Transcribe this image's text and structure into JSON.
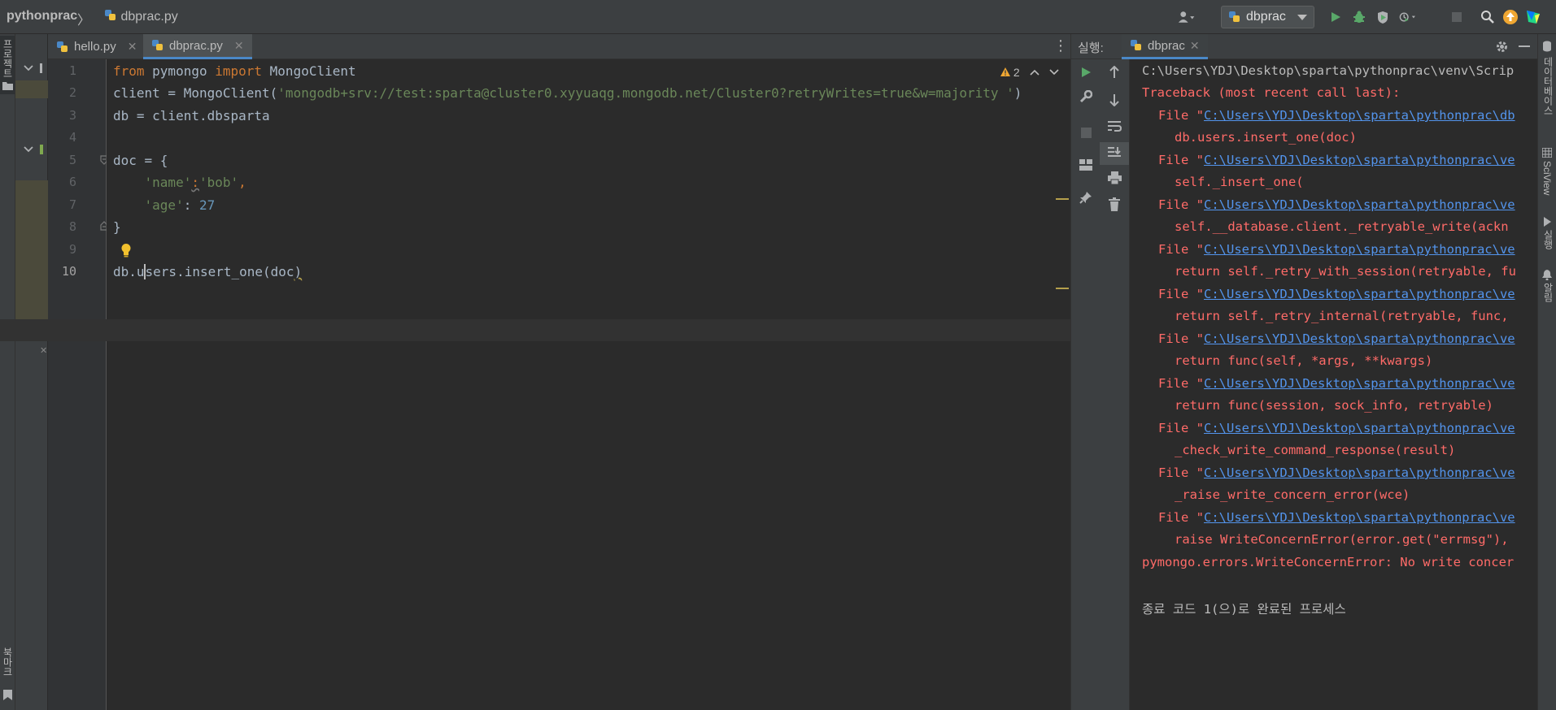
{
  "breadcrumb": {
    "project": "pythonprac",
    "separator": "〉",
    "file": "dbprac.py"
  },
  "toolbar": {
    "run_config": "dbprac",
    "user_icon": "user-icon",
    "run_icon": "run-icon",
    "debug_icon": "debug-icon",
    "coverage_icon": "coverage-icon",
    "profile_icon": "profile-icon",
    "stop_icon": "stop-icon",
    "search_icon": "search-icon",
    "update_icon": "update-icon",
    "jetbrains_icon": "jetbrains-icon"
  },
  "left_stripe": {
    "project_label": "프로젝트",
    "bookmarks_label": "북마크"
  },
  "tabs": [
    {
      "label": "hello.py",
      "close": "✕"
    },
    {
      "label": "dbprac.py",
      "close": "✕"
    }
  ],
  "editor": {
    "warning_count": "2",
    "line_numbers": [
      "1",
      "2",
      "3",
      "4",
      "5",
      "6",
      "7",
      "8",
      "9",
      "10"
    ]
  },
  "run_panel": {
    "label": "실행:",
    "tab_label": "dbprac",
    "tab_close": "✕"
  },
  "console": {
    "command": "C:\\Users\\YDJ\\Desktop\\sparta\\pythonprac\\venv\\Scrip",
    "traceback_header": "Traceback (most recent call last):",
    "entries": [
      {
        "link": "C:\\Users\\YDJ\\Desktop\\sparta\\pythonprac\\db",
        "code": "db.users.insert_one(doc)"
      },
      {
        "link": "C:\\Users\\YDJ\\Desktop\\sparta\\pythonprac\\ve",
        "code": "self._insert_one("
      },
      {
        "link": "C:\\Users\\YDJ\\Desktop\\sparta\\pythonprac\\ve",
        "code": "self.__database.client._retryable_write(ackn"
      },
      {
        "link": "C:\\Users\\YDJ\\Desktop\\sparta\\pythonprac\\ve",
        "code": "return self._retry_with_session(retryable, fu"
      },
      {
        "link": "C:\\Users\\YDJ\\Desktop\\sparta\\pythonprac\\ve",
        "code": "return self._retry_internal(retryable, func,"
      },
      {
        "link": "C:\\Users\\YDJ\\Desktop\\sparta\\pythonprac\\ve",
        "code": "return func(self, *args, **kwargs)"
      },
      {
        "link": "C:\\Users\\YDJ\\Desktop\\sparta\\pythonprac\\ve",
        "code": "return func(session, sock_info, retryable)"
      },
      {
        "link": "C:\\Users\\YDJ\\Desktop\\sparta\\pythonprac\\ve",
        "code": "_check_write_command_response(result)"
      },
      {
        "link": "C:\\Users\\YDJ\\Desktop\\sparta\\pythonprac\\ve",
        "code": "_raise_write_concern_error(wce)"
      },
      {
        "link": "C:\\Users\\YDJ\\Desktop\\sparta\\pythonprac\\ve",
        "code": "raise WriteConcernError(error.get(\"errmsg\"),"
      }
    ],
    "file_prefix": "File \"",
    "error_line": "pymongo.errors.WriteConcernError: No write concer",
    "exit_message": "종료 코드 1(으)로 완료된 프로세스"
  },
  "right_stripe": {
    "database_label": "데이터베이스",
    "sciview_label": "SciView",
    "run_label": "실행",
    "notifications_label": "알림"
  }
}
